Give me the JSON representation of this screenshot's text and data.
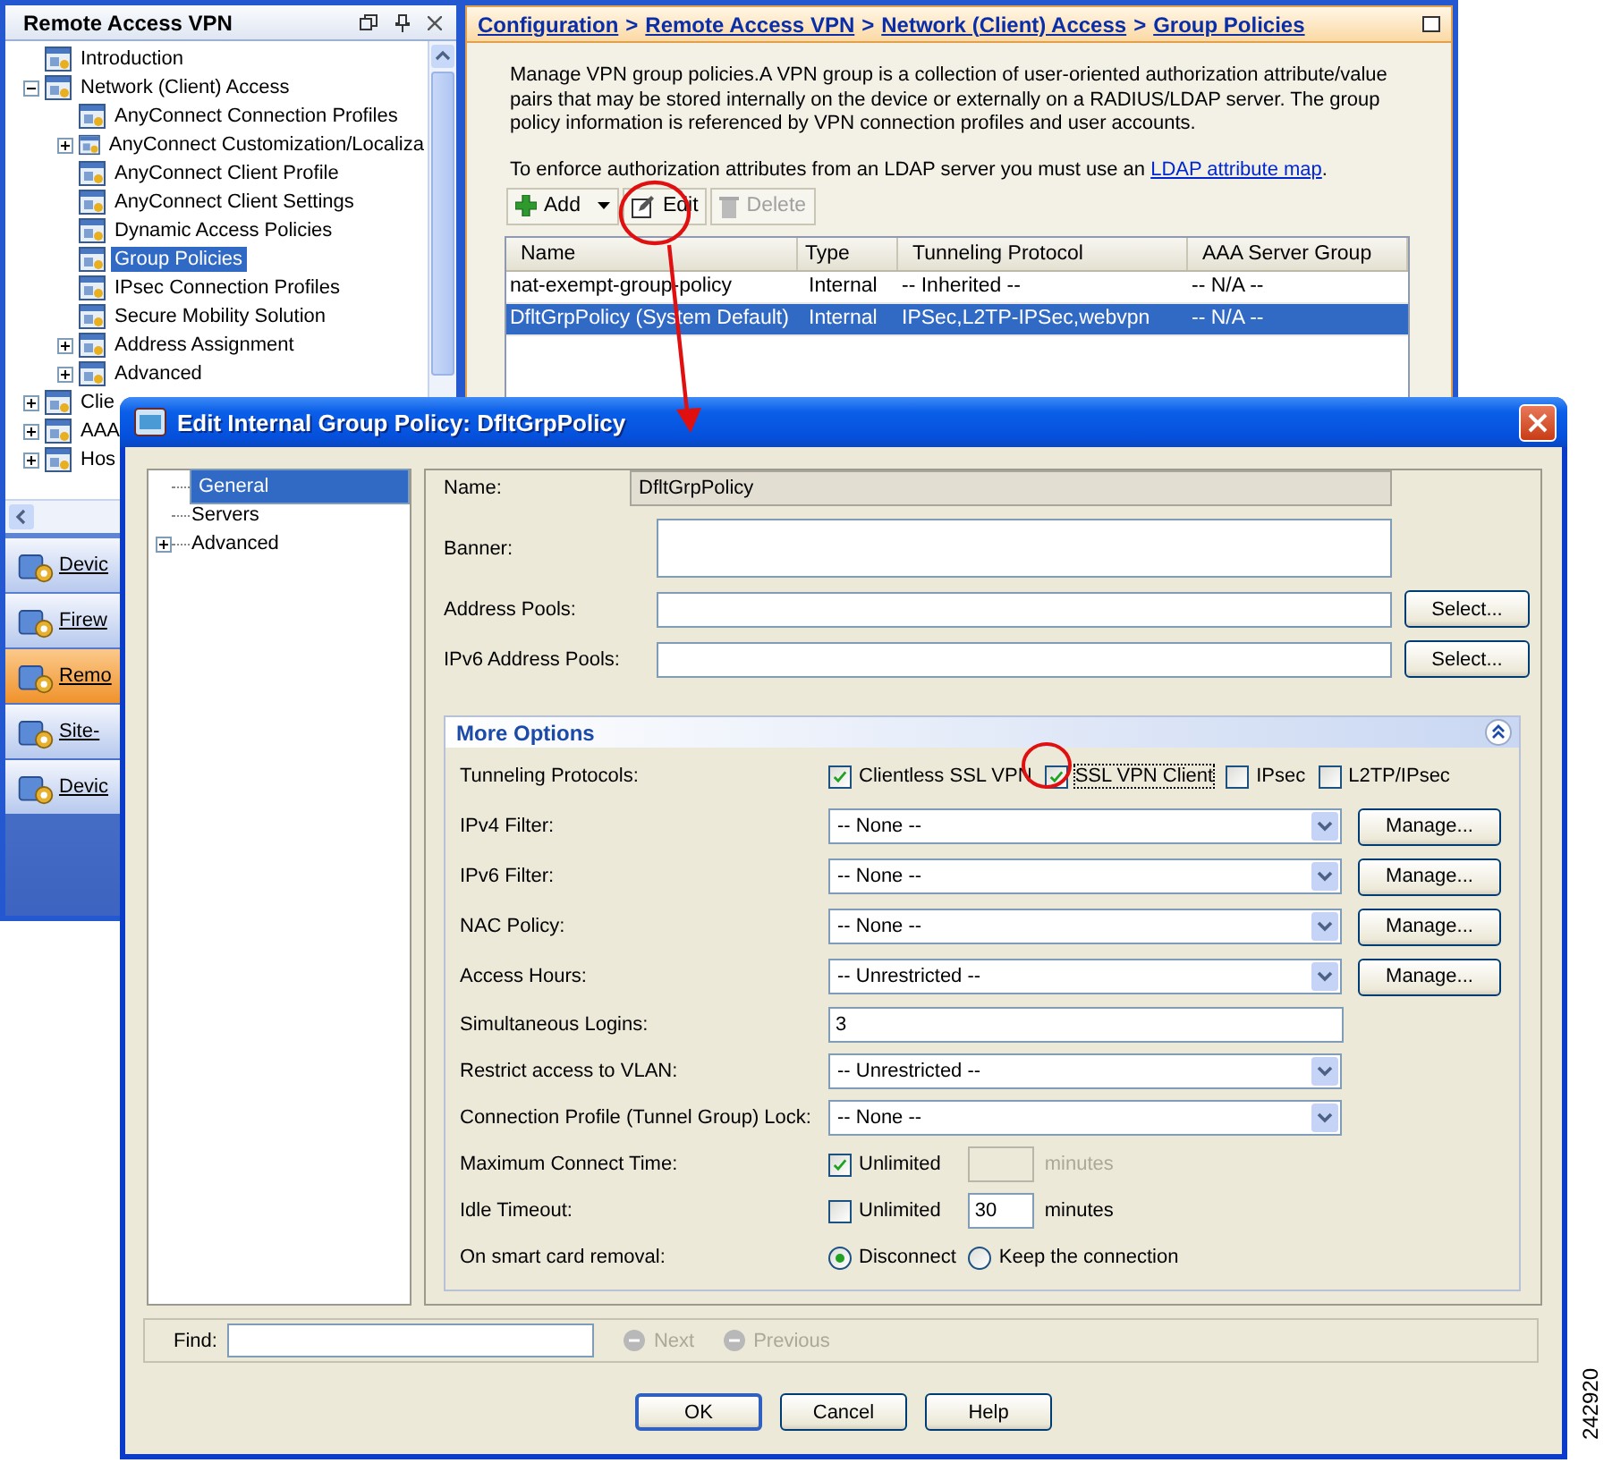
{
  "main_window": {
    "navigation_panel": {
      "title": "Remote Access VPN",
      "tree": [
        {
          "label": "Introduction",
          "selected": false
        },
        {
          "label": "Network (Client) Access",
          "selected": false,
          "expanded": true,
          "children": [
            {
              "label": "AnyConnect Connection Profiles",
              "selected": false
            },
            {
              "label": "AnyConnect Customization/Localiza",
              "selected": false,
              "expanded": false
            },
            {
              "label": "AnyConnect Client Profile",
              "selected": false
            },
            {
              "label": "AnyConnect Client Settings",
              "selected": false
            },
            {
              "label": "Dynamic Access Policies",
              "selected": false
            },
            {
              "label": "Group Policies",
              "selected": true
            },
            {
              "label": "IPsec Connection Profiles",
              "selected": false
            },
            {
              "label": "Secure Mobility Solution",
              "selected": false
            },
            {
              "label": "Address Assignment",
              "selected": false,
              "expanded": false
            },
            {
              "label": "Advanced",
              "selected": false,
              "expanded": false
            }
          ]
        },
        {
          "label": "Clie",
          "selected": false,
          "expanded": false
        },
        {
          "label": "AAA",
          "selected": false,
          "expanded": false
        },
        {
          "label": "Hos",
          "selected": false,
          "expanded": false
        }
      ],
      "nav_buttons": [
        {
          "label": "Devic",
          "selected": false
        },
        {
          "label": "Firew",
          "selected": false
        },
        {
          "label": "Remo",
          "selected": true
        },
        {
          "label": "Site-",
          "selected": false
        },
        {
          "label": "Devic",
          "selected": false
        }
      ]
    },
    "content_panel": {
      "breadcrumb": {
        "items": [
          "Configuration",
          "Remote Access VPN",
          "Network (Client) Access",
          "Group Policies"
        ],
        "separator": ">"
      },
      "description": "Manage VPN group policies.A VPN group is a collection of user-oriented authorization attribute/value pairs that may be stored internally on the device or externally on a RADIUS/LDAP server. The group policy information is referenced by VPN connection profiles and user accounts.",
      "ldap_note": {
        "text": "To enforce authorization attributes from an LDAP server you must use an",
        "link": "LDAP attribute map",
        "after": "."
      },
      "toolbar": [
        {
          "label": "Add",
          "disabled": false,
          "kind": "add"
        },
        {
          "label": "Edit",
          "disabled": false,
          "kind": "edit"
        },
        {
          "label": "Delete",
          "disabled": true,
          "kind": "delete"
        }
      ],
      "table": {
        "columns": [
          "Name",
          "Type",
          "Tunneling Protocol",
          "AAA Server Group"
        ],
        "rows": [
          {
            "cells": [
              "nat-exempt-group-policy",
              "Internal",
              "-- Inherited --",
              "-- N/A --"
            ],
            "selected": false
          },
          {
            "cells": [
              "DfltGrpPolicy (System Default)",
              "Internal",
              "IPSec,L2TP-IPSec,webvpn",
              "-- N/A --"
            ],
            "selected": true
          }
        ]
      }
    }
  },
  "dialog": {
    "title": "Edit Internal Group Policy: DfltGrpPolicy",
    "tree": [
      {
        "label": "General",
        "selected": true
      },
      {
        "label": "Servers",
        "selected": false
      },
      {
        "label": "Advanced",
        "selected": false,
        "expanded": false
      }
    ],
    "name": {
      "label": "Name:",
      "value": "DfltGrpPolicy"
    },
    "banner": {
      "label": "Banner:"
    },
    "address_pools": {
      "label": "Address Pools:",
      "button": "Select..."
    },
    "ipv6_address_pools": {
      "label": "IPv6 Address Pools:",
      "button": "Select..."
    },
    "more_options": {
      "title": "More Options",
      "expanded": true,
      "rows": [
        {
          "kind": "checkboxes",
          "label": "Tunneling Protocols:",
          "options": [
            {
              "label": "Clientless SSL VPN",
              "checked": true,
              "focused": false
            },
            {
              "label": "SSL VPN Client",
              "checked": true,
              "focused": true
            },
            {
              "label": "IPsec",
              "checked": false,
              "focused": false
            },
            {
              "label": "L2TP/IPsec",
              "checked": false,
              "focused": false
            }
          ]
        },
        {
          "kind": "select",
          "label": "IPv4 Filter:",
          "value": "-- None --",
          "button": "Manage..."
        },
        {
          "kind": "select",
          "label": "IPv6 Filter:",
          "value": "-- None --",
          "button": "Manage..."
        },
        {
          "kind": "select",
          "label": "NAC Policy:",
          "value": "-- None --",
          "button": "Manage..."
        },
        {
          "kind": "select",
          "label": "Access Hours:",
          "value": "-- Unrestricted --",
          "button": "Manage..."
        },
        {
          "kind": "text",
          "label": "Simultaneous Logins:",
          "value": "3"
        },
        {
          "kind": "select",
          "label": "Restrict access to VLAN:",
          "value": "-- Unrestricted --"
        },
        {
          "kind": "select",
          "label": "Connection Profile (Tunnel Group) Lock:",
          "value": "-- None --"
        },
        {
          "kind": "unlimited",
          "label": "Maximum Connect Time:",
          "checkbox_label": "Unlimited",
          "checked": true,
          "unit": "minutes",
          "disabled": true
        },
        {
          "kind": "unlimited",
          "label": "Idle Timeout:",
          "checkbox_label": "Unlimited",
          "checked": false,
          "value": "30",
          "unit": "minutes",
          "disabled": false
        },
        {
          "kind": "radios",
          "label": "On smart card removal:",
          "options": [
            {
              "label": "Disconnect",
              "selected": true
            },
            {
              "label": "Keep the connection",
              "selected": false
            }
          ]
        }
      ]
    },
    "find": {
      "label": "Find:",
      "next": {
        "label": "Next",
        "disabled": true
      },
      "previous": {
        "label": "Previous",
        "disabled": true
      }
    },
    "buttons": [
      {
        "label": "OK",
        "default": true
      },
      {
        "label": "Cancel",
        "default": false
      },
      {
        "label": "Help",
        "default": false
      }
    ]
  },
  "figure_number": "242920"
}
